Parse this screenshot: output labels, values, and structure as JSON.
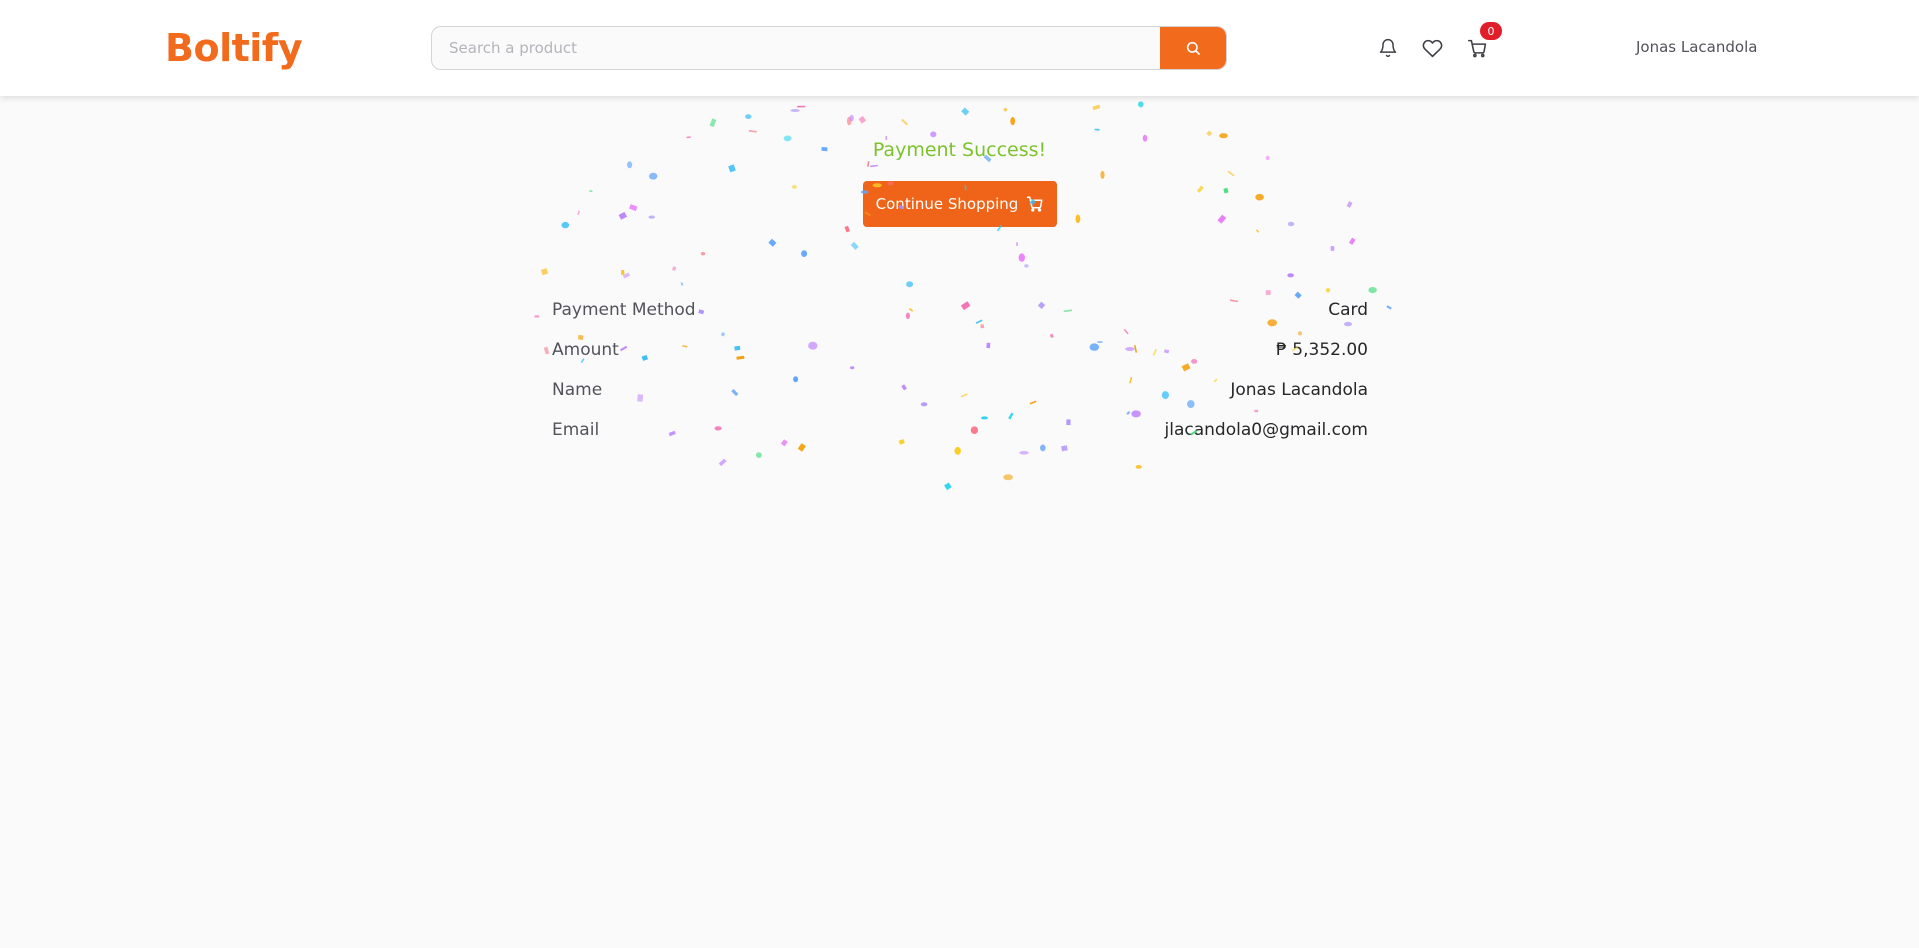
{
  "header": {
    "logo": "Boltify",
    "search": {
      "placeholder": "Search a product",
      "value": ""
    },
    "cart_count": "0",
    "user_name": "Jonas Lacandola",
    "icons": [
      "bell-icon",
      "heart-icon",
      "cart-icon",
      "search-icon"
    ]
  },
  "main": {
    "status_title": "Payment Success!",
    "continue_label": "Continue Shopping",
    "details": [
      {
        "label": "Payment Method",
        "value": "Card"
      },
      {
        "label": "Amount",
        "value": "₱ 5,352.00"
      },
      {
        "label": "Name",
        "value": "Jonas Lacandola"
      },
      {
        "label": "Email",
        "value": "jlacandola0@gmail.com"
      }
    ]
  },
  "colors": {
    "brand": "#f26b1d",
    "success": "#7cc22a",
    "badge": "#e11d2a",
    "background": "#fafafa"
  }
}
